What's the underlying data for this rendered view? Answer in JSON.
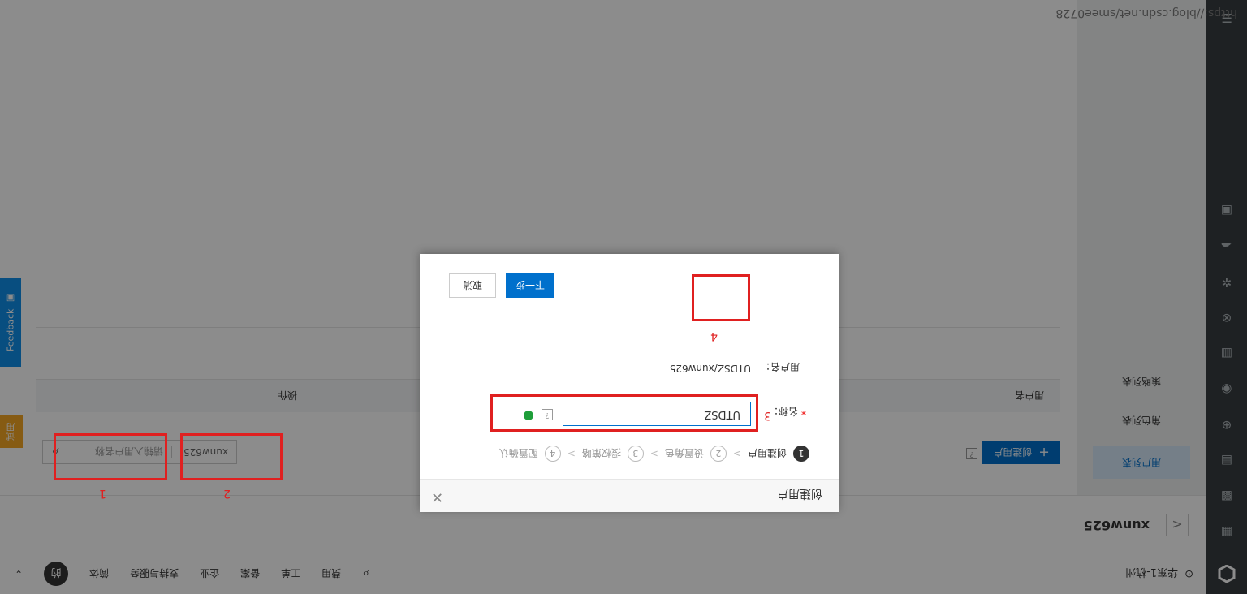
{
  "watermark": "https://blog.csdn.net/smee0728",
  "topbar": {
    "region": "华东1-杭州",
    "nav": [
      "费用",
      "工单",
      "备案",
      "企业",
      "支持与服务",
      "简体"
    ],
    "avatar": "的"
  },
  "subheader": {
    "back": "<",
    "app_name": "xunw625"
  },
  "submenu": {
    "items": [
      "用户列表",
      "角色列表",
      "策略列表"
    ]
  },
  "main": {
    "create_button": "创建用户",
    "search": {
      "select": "xunw625/",
      "placeholder": "请输入用户名称"
    },
    "table_headers": [
      "用户名",
      "操作"
    ],
    "right_tab": "试用",
    "feedback": "Feedback"
  },
  "dialog": {
    "title": "创建用户",
    "steps": [
      {
        "num": "1",
        "label": "创建用户"
      },
      {
        "num": "2",
        "label": "设置角色"
      },
      {
        "num": "3",
        "label": "授权策略"
      },
      {
        "num": "4",
        "label": "配置确认"
      }
    ],
    "field": {
      "required_mark": "*",
      "label": "名称：",
      "value": "UTDSZ"
    },
    "username": {
      "label": "用户名：",
      "value": "UTDSZ/xunw625"
    },
    "next_button": "下一步",
    "cancel_button": "取消"
  },
  "annotations": [
    "1",
    "2",
    "3",
    "4"
  ],
  "colors": {
    "primary": "#0070cc",
    "annotation": "#e02020",
    "rail": "#373d41",
    "overlay": "rgba(0,0,0,0.45)"
  }
}
